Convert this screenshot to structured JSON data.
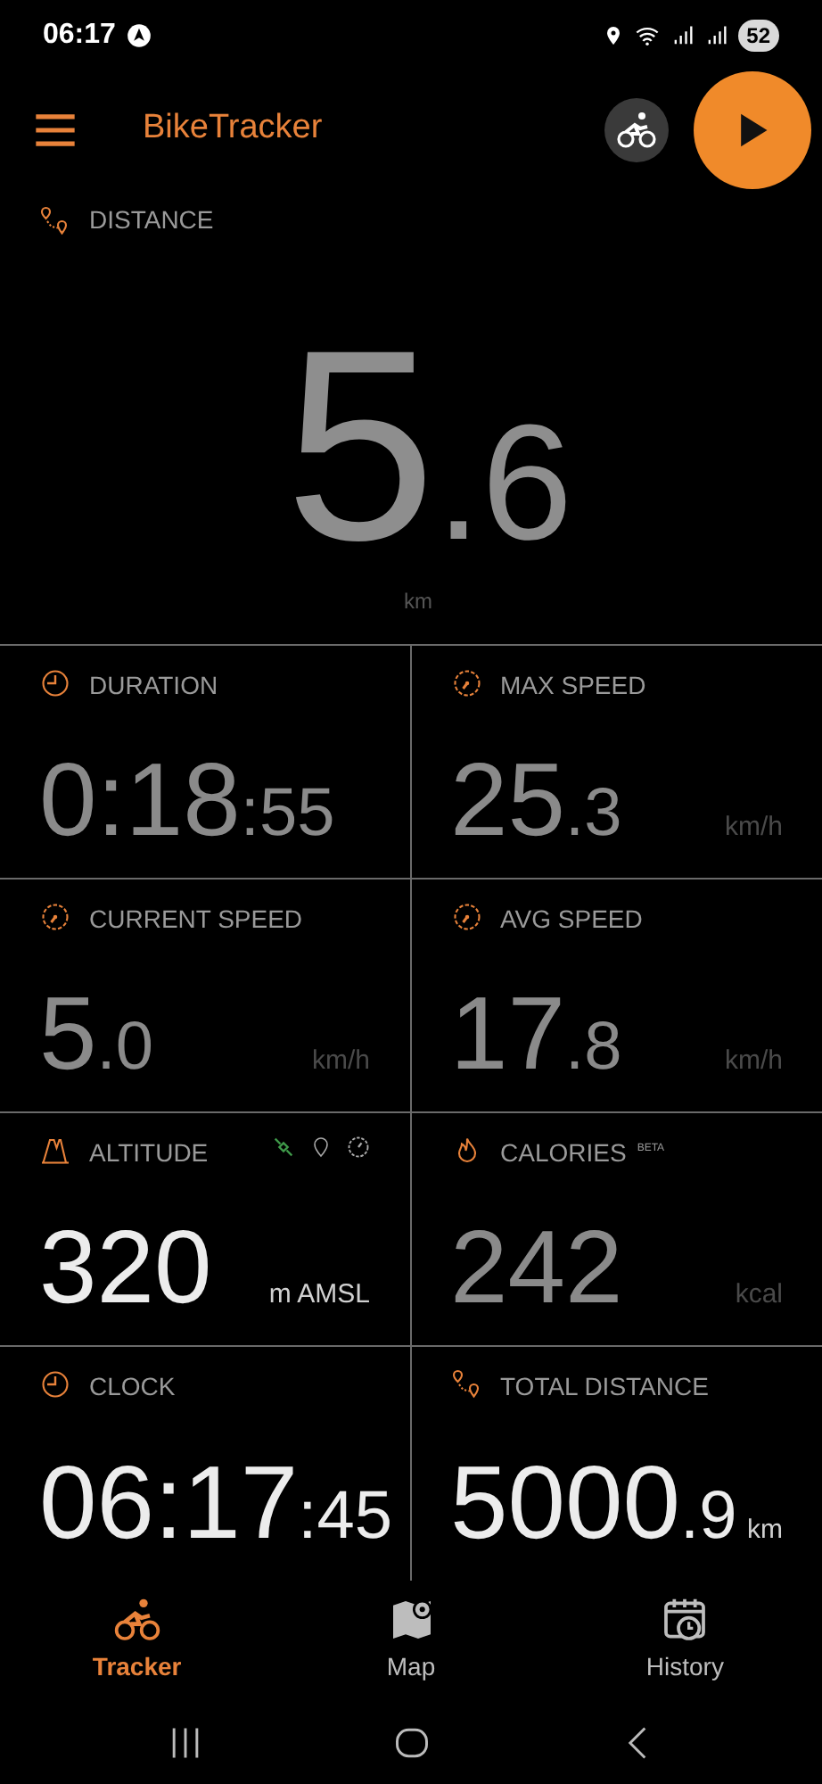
{
  "status_bar": {
    "time": "06:17",
    "battery": "52"
  },
  "app_bar": {
    "title": "BikeTracker"
  },
  "distance": {
    "label": "DISTANCE",
    "value": "5",
    "fraction": ".6",
    "unit": "km"
  },
  "tiles": [
    {
      "kind": "duration",
      "label": "DURATION",
      "value": "0:18",
      "fraction": ":55",
      "active": false
    },
    {
      "kind": "max_speed",
      "label": "MAX SPEED",
      "value": "25",
      "fraction": ".3",
      "unit": "km/h",
      "active": false
    },
    {
      "kind": "current_speed",
      "label": "CURRENT SPEED",
      "value": "5",
      "fraction": ".0",
      "unit": "km/h",
      "active": false
    },
    {
      "kind": "avg_speed",
      "label": "AVG SPEED",
      "value": "17",
      "fraction": ".8",
      "unit": "km/h",
      "active": false
    },
    {
      "kind": "altitude",
      "label": "ALTITUDE",
      "value": "320",
      "unit": "m AMSL",
      "active": true
    },
    {
      "kind": "calories",
      "label": "CALORIES",
      "badge": "BETA",
      "value": "242",
      "unit": "kcal",
      "active": false
    },
    {
      "kind": "clock",
      "label": "CLOCK",
      "value": "06:17",
      "fraction": ":45",
      "active": true
    },
    {
      "kind": "total_distance",
      "label": "TOTAL DISTANCE",
      "value": "5000",
      "fraction": ".9",
      "unit": "km",
      "active": true
    }
  ],
  "bottom_nav": [
    {
      "label": "Tracker",
      "selected": true
    },
    {
      "label": "Map",
      "selected": false
    },
    {
      "label": "History",
      "selected": false
    }
  ]
}
